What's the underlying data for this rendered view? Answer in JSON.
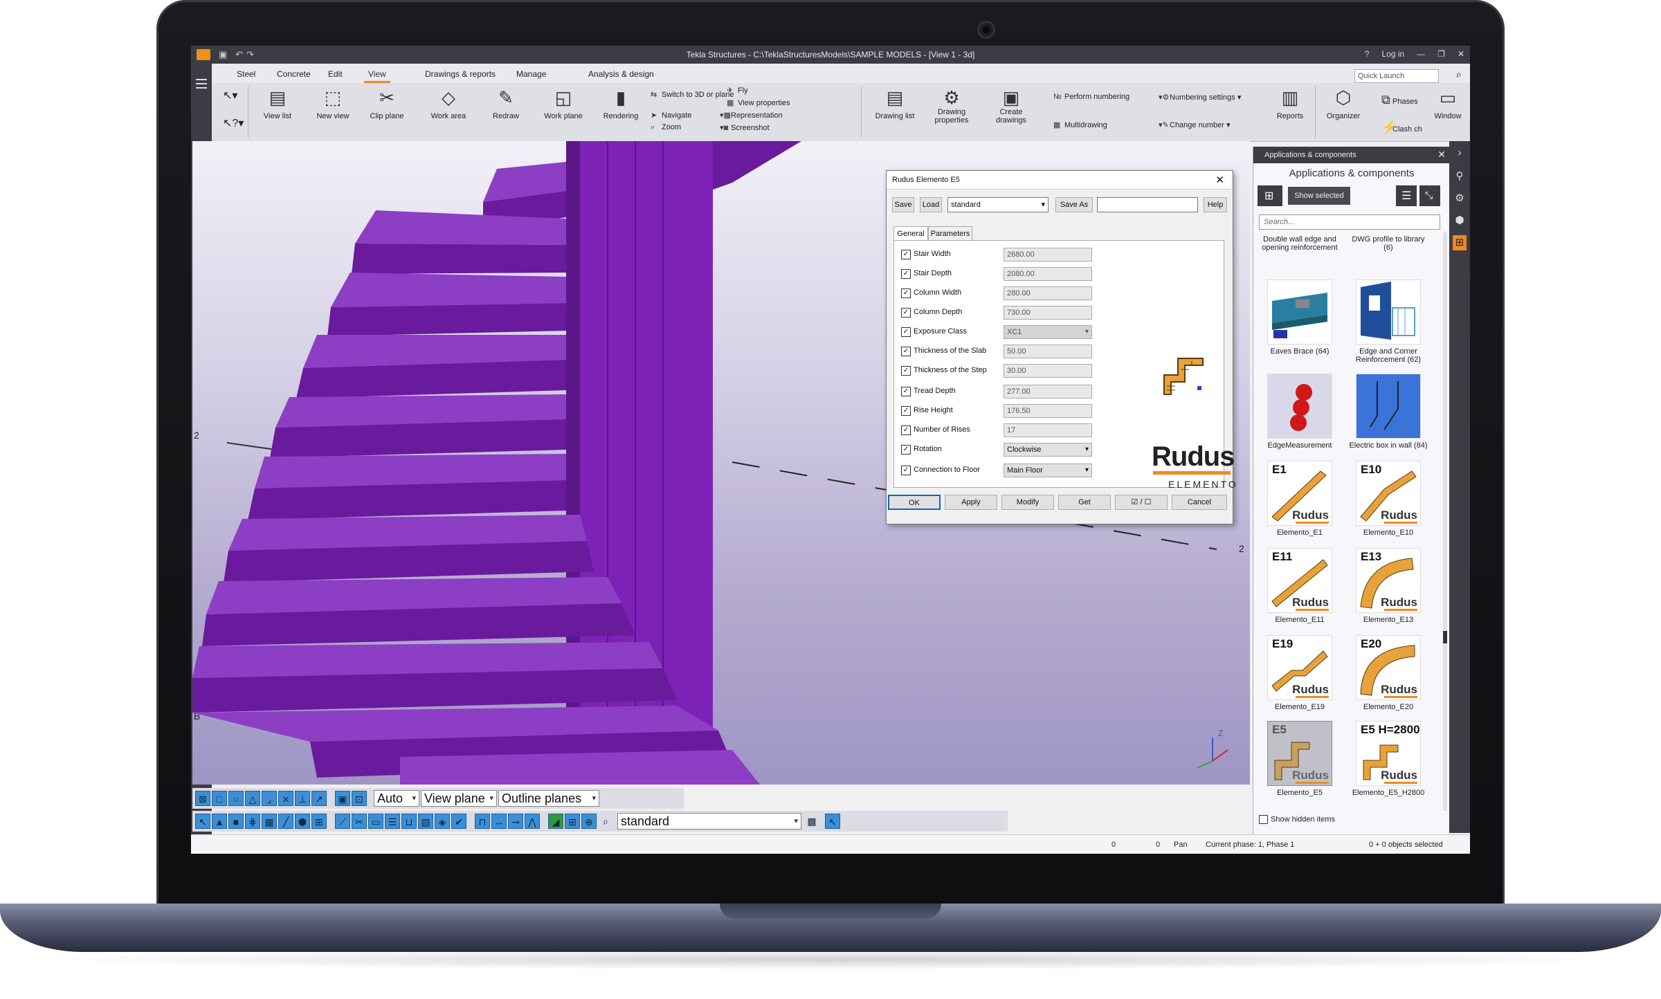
{
  "window": {
    "title": "Tekla Structures - C:\\TeklaStructuresModels\\SAMPLE MODELS - [View 1 - 3d]",
    "login": "Log in",
    "help": "?",
    "minimize": "—",
    "restore": "❐",
    "close": "✕"
  },
  "menu": {
    "items": [
      "Steel",
      "Concrete",
      "Edit",
      "View",
      "Drawings & reports",
      "Manage",
      "Analysis & design"
    ],
    "active": "View"
  },
  "quick_launch": {
    "placeholder": "Quick Launch"
  },
  "ribbon": {
    "view_list": "View list",
    "new_view": "New view",
    "clip_plane": "Clip plane",
    "work_area": "Work area",
    "redraw": "Redraw",
    "work_plane": "Work plane",
    "rendering": "Rendering",
    "switch_3d": "Switch to 3D or plane",
    "navigate": "Navigate",
    "zoom": "Zoom",
    "fly": "Fly",
    "view_properties": "View properties",
    "representation": "Representation",
    "screenshot": "Screenshot",
    "drawing_list": "Drawing list",
    "drawing_properties_1": "Drawing",
    "drawing_properties_2": "properties",
    "create_drawings_1": "Create",
    "create_drawings_2": "drawings",
    "perform_numbering": "Perform numbering",
    "numbering_settings": "Numbering settings",
    "multidrawing": "Multidrawing",
    "change_number": "Change number",
    "reports": "Reports",
    "organizer": "Organizer",
    "phases": "Phases",
    "clash_check": "Clash ch",
    "window": "Window"
  },
  "viewport": {
    "grid_label_1": "2",
    "grid_label_2": "B",
    "grid_label_3": "2",
    "stair_color": "#7a1fb0"
  },
  "toolbar_bottom": {
    "snap_mode": "Auto",
    "plane_mode": "View plane",
    "plane_type": "Outline planes",
    "filter": "standard"
  },
  "status": {
    "x": "0",
    "y": "0",
    "mode": "Pan",
    "phase": "Current phase: 1, Phase 1",
    "selected": "0 + 0 objects selected"
  },
  "panel": {
    "header": "Applications & components",
    "title": "Applications & components",
    "show_selected": "Show selected",
    "search_placeholder": "Search...",
    "top_items": [
      "Double wall edge and opening reinforcement",
      "DWG profile to library (6)"
    ],
    "items": [
      {
        "label": "Eaves Brace (64)",
        "code": "",
        "brand": ""
      },
      {
        "label": "Edge and Corner Reinforcement (62)",
        "code": "",
        "brand": ""
      },
      {
        "label": "EdgeMeasurement",
        "code": "",
        "brand": ""
      },
      {
        "label": "Electric box in wall (84)",
        "code": "",
        "brand": ""
      },
      {
        "label": "Elemento_E1",
        "code": "E1",
        "brand": "Rudus"
      },
      {
        "label": "Elemento_E10",
        "code": "E10",
        "brand": "Rudus"
      },
      {
        "label": "Elemento_E11",
        "code": "E11",
        "brand": "Rudus"
      },
      {
        "label": "Elemento_E13",
        "code": "E13",
        "brand": "Rudus"
      },
      {
        "label": "Elemento_E19",
        "code": "E19",
        "brand": "Rudus"
      },
      {
        "label": "Elemento_E20",
        "code": "E20",
        "brand": "Rudus"
      },
      {
        "label": "Elemento_E5",
        "code": "E5",
        "brand": "Rudus"
      },
      {
        "label": "Elemento_E5_H2800",
        "code": "E5 H=2800",
        "brand": "Rudus"
      }
    ],
    "show_hidden": "Show hidden items"
  },
  "dialog": {
    "title": "Rudus Elemento E5",
    "save": "Save",
    "load": "Load",
    "preset": "standard",
    "save_as": "Save As",
    "save_as_value": "",
    "help": "Help",
    "tabs": [
      "General",
      "Parameters"
    ],
    "params": [
      {
        "label": "Stair Width",
        "value": "2680.00"
      },
      {
        "label": "Stair Depth",
        "value": "2080.00"
      },
      {
        "label": "Column Width",
        "value": "280.00"
      },
      {
        "label": "Column Depth",
        "value": "730.00"
      },
      {
        "label": "Exposure Class",
        "value": "XC1"
      },
      {
        "label": "Thickness of the Slab",
        "value": "50.00"
      },
      {
        "label": "Thickness of the Step",
        "value": "30.00"
      },
      {
        "label": "Tread Depth",
        "value": "277.00"
      },
      {
        "label": "Rise Height",
        "value": "176.50"
      },
      {
        "label": "Number of Rises",
        "value": "17"
      },
      {
        "label": "Rotation",
        "value": "Clockwise"
      },
      {
        "label": "Connection to Floor",
        "value": "Main Floor"
      }
    ],
    "logo_brand": "Rudus",
    "logo_sub": "ELEMENTO",
    "ok": "OK",
    "apply": "Apply",
    "modify": "Modify",
    "get": "Get",
    "toggle": "☑ / ☐",
    "cancel": "Cancel"
  },
  "colors": {
    "accent": "#f08a1c",
    "dark_chrome": "#3c3c44",
    "toolbar_blue": "#3b8fd6"
  }
}
